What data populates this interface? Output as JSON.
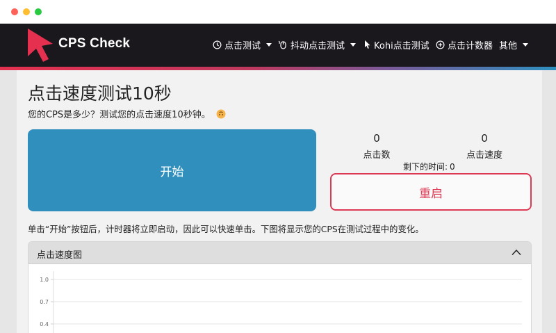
{
  "brand": {
    "name": "CPS Check",
    "accent": "#e5304f"
  },
  "nav": {
    "items": [
      {
        "label": "点击测试",
        "icon": "clock-icon",
        "has_caret": true
      },
      {
        "label": "抖动点击测试",
        "icon": "mouse-icon",
        "has_caret": true
      },
      {
        "label": "Kohi点击测试",
        "icon": "pointer-icon",
        "has_caret": false
      },
      {
        "label": "点击计数器",
        "icon": "plus-circle-icon",
        "has_caret": false
      },
      {
        "label": "其他",
        "icon": "",
        "has_caret": true
      }
    ]
  },
  "page": {
    "title": "点击速度测试10秒",
    "subtitle": "您的CPS是多少？测试您的点击速度10秒钟。",
    "instruction": "单击“开始”按钮后，计时器将立即启动，因此可以快速单击。下图将显示您的CPS在测试过程中的变化。"
  },
  "test": {
    "start_label": "开始",
    "restart_label": "重启",
    "clicks_value": "0",
    "clicks_label": "点击数",
    "speed_value": "0",
    "speed_label": "点击速度",
    "remaining_label": "剩下的时间:",
    "remaining_value": "0",
    "start_color": "#318fbd",
    "restart_color": "#dc3a55"
  },
  "chart_panel": {
    "title": "点击速度图"
  },
  "chart_data": {
    "type": "line",
    "title": "",
    "xlabel": "",
    "ylabel": "",
    "y_ticks": [
      "1.0",
      "0.7",
      "0.4"
    ],
    "ylim": [
      0,
      1.0
    ],
    "series": [],
    "grid": true
  }
}
